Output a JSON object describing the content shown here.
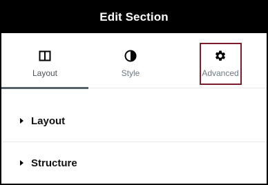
{
  "header": {
    "title": "Edit Section"
  },
  "tabs": [
    {
      "label": "Layout",
      "icon": "columns-icon",
      "active": true
    },
    {
      "label": "Style",
      "icon": "half-circle-icon",
      "active": false
    },
    {
      "label": "Advanced",
      "icon": "gear-icon",
      "active": false
    }
  ],
  "sections": [
    {
      "label": "Layout",
      "icon": "caret-right-icon"
    },
    {
      "label": "Structure",
      "icon": "caret-right-icon"
    }
  ],
  "colors": {
    "header_bg": "#000000",
    "highlight": "#7a1a2b",
    "tab_text": "#6d7882",
    "active_underline": "#556068"
  }
}
